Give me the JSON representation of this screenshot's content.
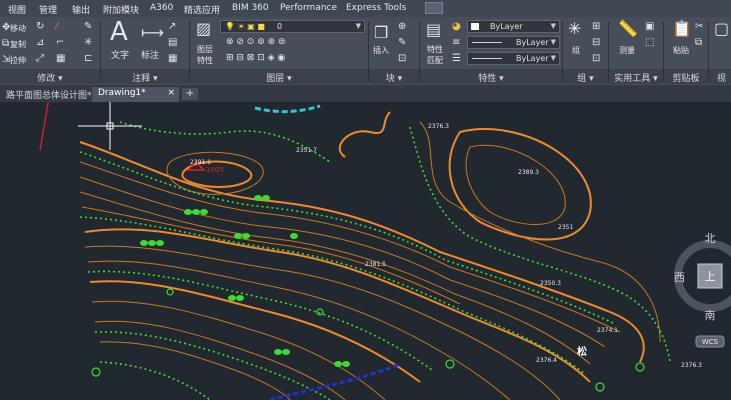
{
  "menu": {
    "tabs": [
      "视图",
      "管理",
      "输出",
      "附加模块",
      "A360",
      "精选应用",
      "BIM 360",
      "Performance",
      "Express Tools"
    ]
  },
  "ribbon": {
    "modify_tools": [
      "移动",
      "复制",
      "拉伸"
    ],
    "text_label": "文字",
    "dim_label": "标注",
    "layer_props_label": "图层\n特性",
    "layer_props_l1": "图层",
    "layer_props_l2": "特性",
    "layer_combo_value": "0",
    "insert_label": "插入",
    "match_l1": "特性",
    "match_l2": "匹配",
    "color_value": "ByLayer",
    "linetype_value": "ByLayer",
    "lineweight_value": "ByLayer",
    "group_label": "组",
    "measure_label": "测量",
    "paste_label": "粘贴",
    "panels": {
      "modify": "修改 ▾",
      "annotation": "注释 ▾",
      "layers": "图层 ▾",
      "block": "块 ▾",
      "properties": "特性 ▾",
      "groups": "组 ▾",
      "utilities": "实用工具 ▾",
      "clipboard": "剪贴板",
      "view": "视图"
    }
  },
  "doc_tabs": {
    "first": "路平面图总体设计图*",
    "second": "Drawing1*",
    "add": "+"
  },
  "viewcube": {
    "north": "北",
    "west": "西",
    "south": "南",
    "top": "上",
    "wcs": "WCS"
  },
  "drawing": {
    "elevations": [
      "2376.3",
      "2351.7",
      "2391.1",
      "2389.3",
      "2351",
      "2381.5",
      "2350.3",
      "2374.1",
      "2376.4",
      "2376.3"
    ],
    "highlight_label": "1005",
    "tree_label": "松"
  },
  "colors": {
    "contour_major": "#f0892a",
    "contour_minor": "#c9781f",
    "green_marks": "#3ddc2f",
    "cyan": "#29c9d8",
    "blue": "#2233cc",
    "red": "#d92020"
  }
}
